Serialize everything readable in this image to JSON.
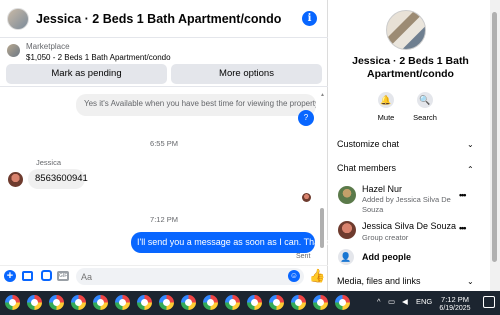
{
  "header": {
    "title": "Jessica · 2 Beds 1 Bath Apartment/condo",
    "info_icon": "i"
  },
  "marketplace": {
    "label": "Marketplace",
    "item": "$1,050 - 2 Beds 1 Bath Apartment/condo",
    "pending_button": "Mark as pending",
    "more_button": "More options"
  },
  "messages": {
    "cut_message": "Yes it's Available when you have best time for viewing the property..Ple...",
    "question_bubble": "?",
    "time_1": "6:55 PM",
    "sender_name": "Jessica",
    "phone_message": "8563600941",
    "time_2": "7:12 PM",
    "my_message": "I'll send you a message as soon as I can. Thanks",
    "sent_status": "Sent"
  },
  "composer": {
    "placeholder": "Aa"
  },
  "info_panel": {
    "title": "Jessica · 2 Beds 1 Bath Apartment/condo",
    "mute_label": "Mute",
    "search_label": "Search",
    "customize_chat": "Customize chat",
    "chat_members": "Chat members",
    "members": [
      {
        "name": "Hazel Nur",
        "sub": "Added by Jessica Silva De Souza"
      },
      {
        "name": "Jessica Silva De Souza",
        "sub": "Group creator"
      }
    ],
    "add_people": "Add people",
    "media_files_links": "Media, files and links"
  },
  "taskbar": {
    "lang": "ENG",
    "time": "7:12 PM",
    "date": "6/19/2025"
  },
  "colors": {
    "accent": "#0866ff",
    "taskbar": "#1c2530"
  }
}
